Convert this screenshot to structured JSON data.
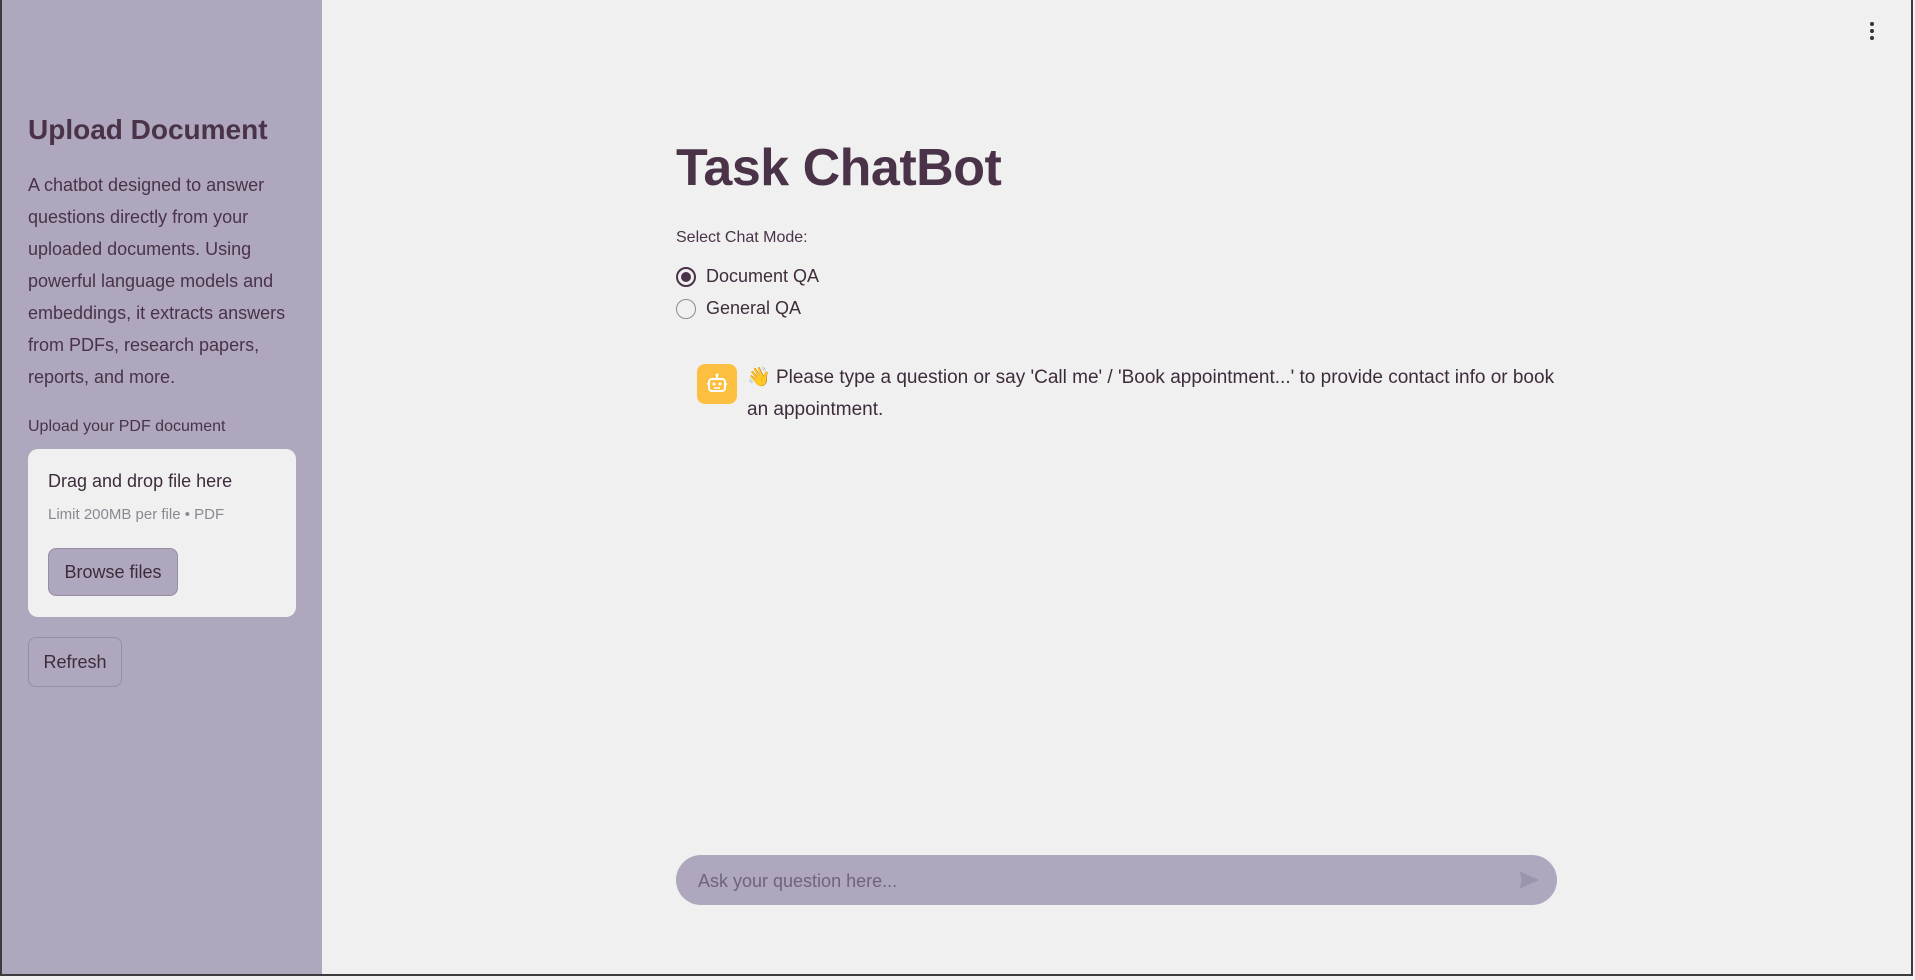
{
  "sidebar": {
    "title": "Upload Document",
    "description": "A chatbot designed to answer questions directly from your uploaded documents. Using powerful language models and embeddings, it extracts answers from PDFs, research papers, reports, and more.",
    "upload_label": "Upload your PDF document",
    "dropzone": {
      "title": "Drag and drop file here",
      "limit": "Limit 200MB per file • PDF",
      "browse_label": "Browse files"
    },
    "refresh_label": "Refresh"
  },
  "header": {
    "menu_icon": "kebab-menu-icon"
  },
  "main": {
    "title": "Task ChatBot",
    "mode_label": "Select Chat Mode:",
    "modes": [
      {
        "label": "Document QA",
        "selected": true
      },
      {
        "label": "General QA",
        "selected": false
      }
    ],
    "messages": [
      {
        "role": "assistant",
        "avatar_icon": "bot-icon",
        "emoji": "👋",
        "text": "Please type a question or say 'Call me' / 'Book appointment...' to provide contact info or book an appointment."
      }
    ],
    "chat_input": {
      "placeholder": "Ask your question here...",
      "send_icon": "send-icon"
    }
  },
  "colors": {
    "sidebar_bg": "#aea7bd",
    "main_bg": "#f0f0f0",
    "text_primary": "#4a3348",
    "bot_avatar": "#fdbf3f"
  }
}
